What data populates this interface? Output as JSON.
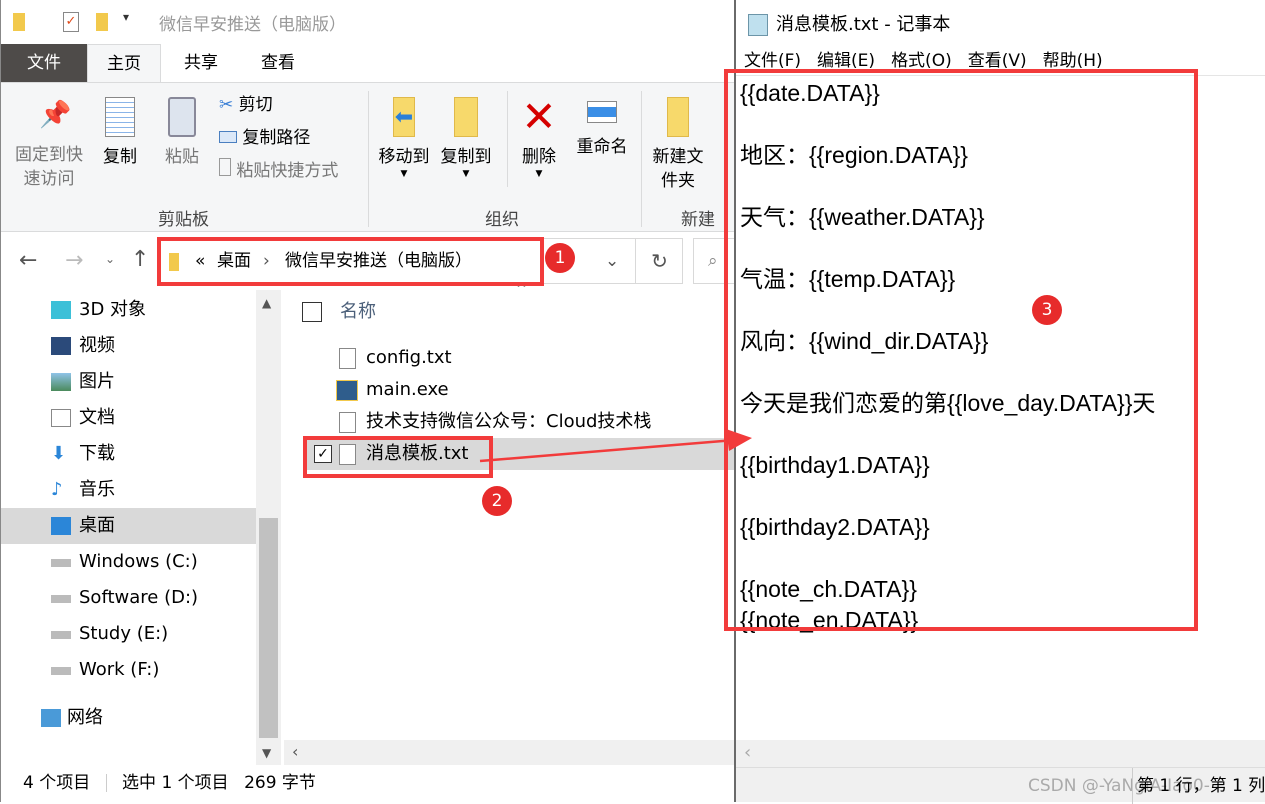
{
  "explorer": {
    "title": "微信早安推送（电脑版）",
    "tabs": [
      {
        "label": "文件"
      },
      {
        "label": "主页"
      },
      {
        "label": "共享"
      },
      {
        "label": "查看"
      }
    ],
    "ribbon": {
      "clipboard": {
        "pin": "固定到快速访问",
        "copy": "复制",
        "paste": "粘贴",
        "cut": "剪切",
        "copy_path": "复制路径",
        "paste_shortcut": "粘贴快捷方式",
        "group": "剪贴板"
      },
      "organize": {
        "move_to": "移动到",
        "copy_to": "复制到",
        "delete": "删除",
        "rename": "重命名",
        "group": "组织"
      },
      "new": {
        "new_folder": "新建文件夹",
        "group": "新建"
      }
    },
    "address": {
      "overflow": "«",
      "crumbs": [
        "桌面",
        "微信早安推送（电脑版）"
      ]
    },
    "sidebar": {
      "items": [
        {
          "label": "3D 对象",
          "icon": "cube-icon"
        },
        {
          "label": "视频",
          "icon": "video-icon"
        },
        {
          "label": "图片",
          "icon": "picture-icon"
        },
        {
          "label": "文档",
          "icon": "document-icon"
        },
        {
          "label": "下载",
          "icon": "download-icon"
        },
        {
          "label": "音乐",
          "icon": "music-icon"
        },
        {
          "label": "桌面",
          "icon": "desktop-icon",
          "selected": true
        },
        {
          "label": "Windows (C:)",
          "icon": "drive-icon"
        },
        {
          "label": "Software (D:)",
          "icon": "drive-icon"
        },
        {
          "label": "Study (E:)",
          "icon": "drive-icon"
        },
        {
          "label": "Work (F:)",
          "icon": "drive-icon"
        },
        {
          "label": "网络",
          "icon": "network-icon"
        }
      ]
    },
    "list": {
      "header": "名称",
      "files": [
        {
          "name": "config.txt"
        },
        {
          "name": "main.exe"
        },
        {
          "name": "技术支持微信公众号：Cloud技术栈"
        },
        {
          "name": "消息模板.txt",
          "selected": true
        }
      ]
    },
    "status": {
      "count": "4 个项目",
      "selected": "选中 1 个项目",
      "size": "269 字节"
    }
  },
  "notepad": {
    "title": "消息模板.txt - 记事本",
    "menu": [
      "文件(F)",
      "编辑(E)",
      "格式(O)",
      "查看(V)",
      "帮助(H)"
    ],
    "lines": [
      "{{date.DATA}}",
      "",
      "地区：{{region.DATA}}",
      "",
      "天气：{{weather.DATA}}",
      "",
      "气温：{{temp.DATA}}",
      "",
      "风向：{{wind_dir.DATA}}",
      "",
      "今天是我们恋爱的第{{love_day.DATA}}天",
      "",
      "{{birthday1.DATA}}",
      "",
      "{{birthday2.DATA}}",
      "",
      "{{note_ch.DATA}}",
      "{{note_en.DATA}}"
    ],
    "status": "第 1 行，第 1 列"
  },
  "annotations": {
    "badges": [
      "1",
      "2",
      "3"
    ],
    "color": "#f23b3b"
  },
  "watermark": "CSDN @-YaNgiA-Iao0-"
}
